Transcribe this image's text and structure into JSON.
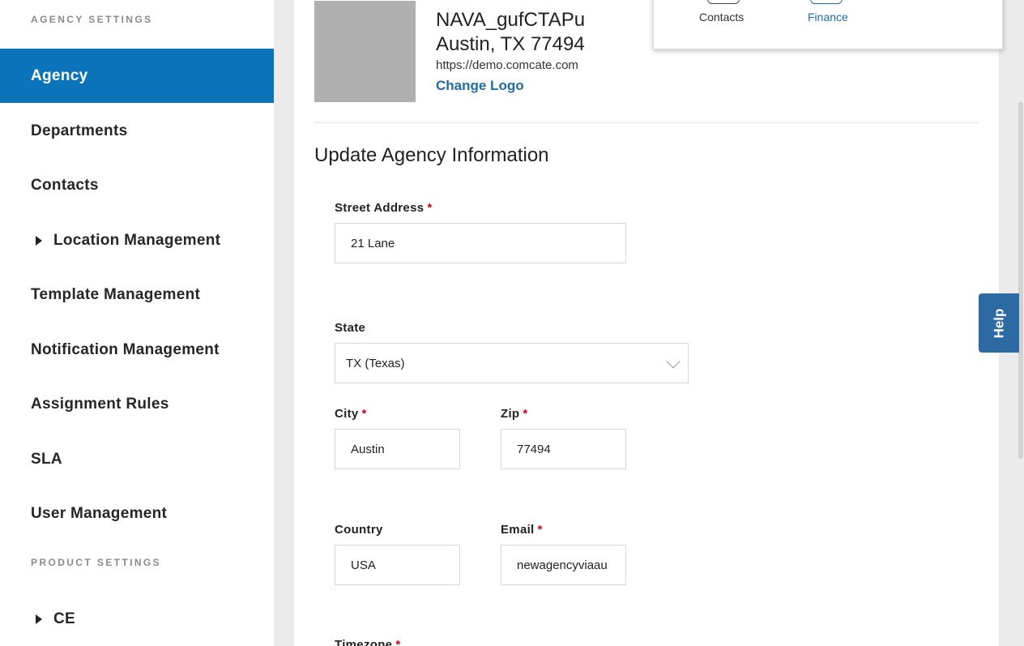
{
  "sidebar": {
    "agency_settings_heading": "AGENCY SETTINGS",
    "product_settings_heading": "PRODUCT SETTINGS",
    "items": [
      {
        "label": "Agency",
        "active": true
      },
      {
        "label": "Departments"
      },
      {
        "label": "Contacts"
      },
      {
        "label": "Location Management",
        "expandable": true
      },
      {
        "label": "Template Management"
      },
      {
        "label": "Notification Management"
      },
      {
        "label": "Assignment Rules"
      },
      {
        "label": "SLA"
      },
      {
        "label": "User Management"
      }
    ],
    "product_items": [
      {
        "label": "CE",
        "expandable": true
      }
    ]
  },
  "agency": {
    "name": "NAVA_gufCTAPu",
    "address": "Austin, TX 77494",
    "url": "https://demo.comcate.com",
    "change_logo": "Change Logo"
  },
  "popup": {
    "tabs": [
      "Contacts",
      "Finance"
    ]
  },
  "form": {
    "title": "Update Agency Information",
    "street_address": {
      "label": "Street Address",
      "value": "21 Lane",
      "required": "*"
    },
    "state": {
      "label": "State",
      "value": "TX (Texas)"
    },
    "city": {
      "label": "City",
      "value": "Austin",
      "required": "*"
    },
    "zip": {
      "label": "Zip",
      "value": "77494",
      "required": "*"
    },
    "country": {
      "label": "Country",
      "value": "USA"
    },
    "email": {
      "label": "Email",
      "value": "newagencyviaau",
      "required": "*"
    },
    "timezone": {
      "label": "Timezone",
      "required": "*"
    }
  },
  "help": {
    "label": "Help"
  },
  "colors": {
    "accent": "#0a73ba",
    "link": "#1f6ca6",
    "required": "#d0021b"
  }
}
